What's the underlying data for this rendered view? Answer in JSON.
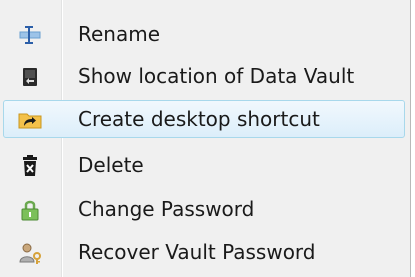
{
  "menu": {
    "items": [
      {
        "label": "Rename",
        "icon": "rename-cursor-icon"
      },
      {
        "label": "Show location of Data Vault",
        "icon": "vault-location-icon"
      },
      {
        "label": "Create desktop shortcut",
        "icon": "folder-shortcut-icon",
        "highlighted": true
      },
      {
        "label": "Delete",
        "icon": "trash-icon"
      },
      {
        "label": "Change Password",
        "icon": "padlock-icon"
      },
      {
        "label": "Recover Vault Password",
        "icon": "user-key-icon"
      }
    ]
  },
  "colors": {
    "highlight_border": "#a8d8eb",
    "highlight_fill": "#dceefa",
    "menu_background": "#f0f0f0"
  }
}
